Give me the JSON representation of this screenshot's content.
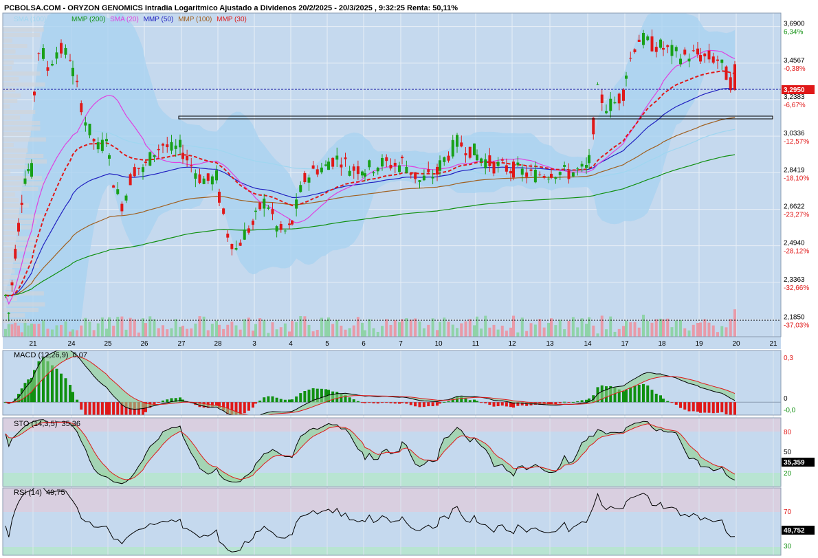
{
  "header": {
    "title": "PCBOLSA.COM - ORYZON GENOMICS Intradia Logaritmico Ajustado a Dividenos 20/2/2025 - 20/3/2025 , 9:32:25 Renta: 50,11%"
  },
  "legend": [
    {
      "label": "SMA (100)",
      "color": "#9fd6f0"
    },
    {
      "label": "",
      "color": "#d8e8f4"
    },
    {
      "label": "MMP (200)",
      "color": "#109010"
    },
    {
      "label": "SMA (20)",
      "color": "#e040e0"
    },
    {
      "label": "MMP (50)",
      "color": "#2020c0"
    },
    {
      "label": "MMP (100)",
      "color": "#a06020"
    },
    {
      "label": "MMP (30)",
      "color": "#e01818"
    }
  ],
  "colors": {
    "panel_bg": "#c5d9ee",
    "bull": "#18a018",
    "bear": "#e01818",
    "band": "#a7d2f0",
    "current_price_box": "#e01818",
    "overbought_zone": "#d9cfe0",
    "oversold_zone": "#b8e4d2"
  },
  "chart_data": [
    {
      "type": "candlestick",
      "panel": "price",
      "scale": "log",
      "x_ticks": [
        "21",
        "24",
        "25",
        "26",
        "27",
        "28",
        "3",
        "4",
        "5",
        "6",
        "7",
        "10",
        "11",
        "12",
        "13",
        "14",
        "17",
        "18",
        "19",
        "20",
        "21"
      ],
      "y_ticks": [
        "3,6900",
        "3,4567",
        "3,2383",
        "3,0336",
        "2,8419",
        "2,6622",
        "2,4940",
        "2,3363",
        "2,1850"
      ],
      "y_range": [
        2.12,
        3.78
      ],
      "renta_ticks": [
        "6,34%",
        "-0,38%",
        "-6,67%",
        "-12,57%",
        "-18,10%",
        "-23,27%",
        "-28,12%",
        "-32,66%",
        "-37,03%"
      ],
      "current_price": "3,2950",
      "daily_closes": [
        {
          "day": "21",
          "close": 2.85
        },
        {
          "day": "24",
          "close": 3.5
        },
        {
          "day": "25",
          "close": 3.05
        },
        {
          "day": "26",
          "close": 2.85
        },
        {
          "day": "27",
          "close": 2.97
        },
        {
          "day": "28",
          "close": 2.82
        },
        {
          "day": "3",
          "close": 2.59
        },
        {
          "day": "4",
          "close": 2.57
        },
        {
          "day": "5",
          "close": 2.87
        },
        {
          "day": "6",
          "close": 2.87
        },
        {
          "day": "7",
          "close": 2.88
        },
        {
          "day": "10",
          "close": 2.84
        },
        {
          "day": "11",
          "close": 2.95
        },
        {
          "day": "12",
          "close": 2.86
        },
        {
          "day": "13",
          "close": 2.84
        },
        {
          "day": "14",
          "close": 2.86
        },
        {
          "day": "17",
          "close": 3.28
        },
        {
          "day": "18",
          "close": 3.56
        },
        {
          "day": "19",
          "close": 3.51
        },
        {
          "day": "20",
          "close": 3.295
        }
      ]
    },
    {
      "type": "line",
      "panel": "macd",
      "label": "MACD (12,26,9)",
      "value": "0,07",
      "y_ticks": [
        "0,3",
        "0",
        "-0,0"
      ],
      "y_range": [
        -0.08,
        0.32
      ]
    },
    {
      "type": "line",
      "panel": "stochastic",
      "label": "STO (14,3,5)",
      "value": "35,36",
      "y_ticks": [
        "80",
        "50",
        "20"
      ],
      "y_range": [
        0,
        100
      ],
      "current": "35,359"
    },
    {
      "type": "line",
      "panel": "rsi",
      "label": "RSI (14)",
      "value": "49,75",
      "y_ticks": [
        "70",
        "30"
      ],
      "y_range": [
        22,
        86
      ],
      "current": "49,752"
    }
  ]
}
